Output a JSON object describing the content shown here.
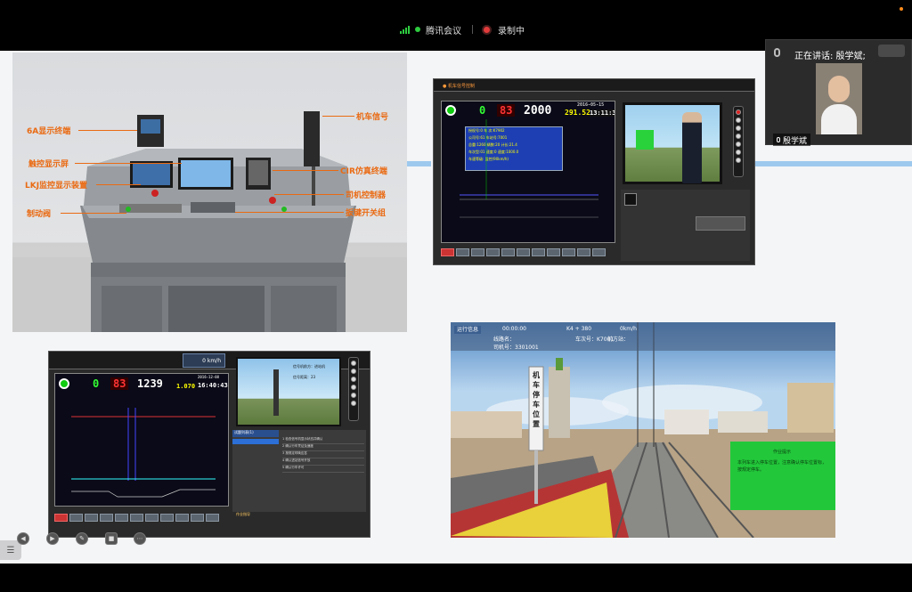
{
  "meeting": {
    "app_name": "腾讯会议",
    "recording_label": "录制中"
  },
  "speaker": {
    "speaking_label": "正在讲话: 殷学斌;",
    "name": "殷学斌"
  },
  "console_labels": {
    "display_6a": "6A显示终端",
    "touch_screen": "触控显示屏",
    "lkj_display": "LKJ监控显示装置",
    "brake_valve": "制动阀",
    "loco_signal": "机车信号",
    "cir_terminal": "CIR仿真终端",
    "driver_controller": "司机控制器",
    "toggle_switches": "扳键开关组"
  },
  "lkj_top": {
    "speed_green": "0",
    "speed_red": "83",
    "limit": "2000",
    "km": "291.524",
    "date": "2016-05-15",
    "time": "13:11:38",
    "info_lines": [
      "授权号:0  车 次:K7902",
      "公司号:61  车站号:7001",
      "总重:1260 辆数:20  计长:21.4",
      "车次型:01  速度:0  速度:1000.0",
      "车速等级:  监控(90km/h)"
    ]
  },
  "lkj_bottom": {
    "speed_green": "0",
    "speed_red": "83",
    "limit": "1239",
    "km": "1.070",
    "date": "2016-12-08",
    "time": "16:40:43",
    "speed_readout": "0 km/h",
    "signal_caption_1": "信号机前方：进站机",
    "signal_caption_2": "信号距离：23",
    "task_title": "试题列表(1)",
    "task_steps": [
      "1  检查信号机显示状态并确认",
      "2  确认行车凭证及速度",
      "3  按规定呼唤应答",
      "4  确认进站信号开放",
      "5  确认行车许可"
    ],
    "footer_text": "作业指导"
  },
  "sim": {
    "header_left": "运行信息",
    "header_time": "00:00:00",
    "header_km": "K4 + 380",
    "header_speed": "0km/h",
    "line_name": "线路名：",
    "train_no": "车次号：K7001",
    "station": "前方站：",
    "driver_no": "司机号：3301001",
    "plate_text": "机车停车位置",
    "popup_title": "作业提示",
    "popup_body": "本列车进入停车位置，注意确认停车位置标，按规定停车。"
  },
  "colors": {
    "orange_label": "#ea6a12",
    "accent_blue": "#9ec9ee",
    "green_popup": "#22c83a"
  }
}
